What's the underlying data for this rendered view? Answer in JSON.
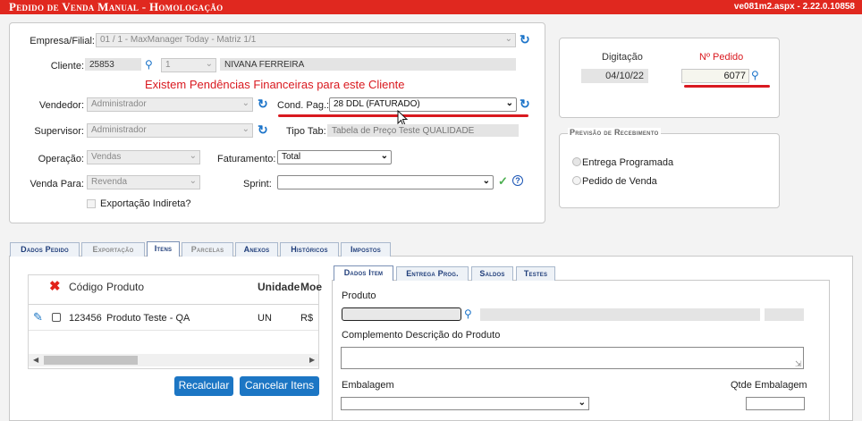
{
  "titlebar": {
    "title": "Pedido de Venda Manual - Homologação",
    "version": "ve081m2.aspx - 2.22.0.10858"
  },
  "form": {
    "empresa_label": "Empresa/Filial:",
    "empresa_value": "01 / 1 - MaxManager Today - Matriz 1/1",
    "cliente_label": "Cliente:",
    "cliente_code": "25853",
    "cliente_seq": "1",
    "cliente_name": "NIVANA FERREIRA",
    "alert": "Existem Pendências Financeiras para este Cliente",
    "vendedor_label": "Vendedor:",
    "vendedor_value": "Administrador",
    "cond_pag_label": "Cond. Pag.:",
    "cond_pag_value": "28 DDL (FATURADO)",
    "supervisor_label": "Supervisor:",
    "supervisor_value": "Administrador",
    "tipo_tab_label": "Tipo Tab:",
    "tipo_tab_value": "Tabela de Preço Teste QUALIDADE",
    "operacao_label": "Operação:",
    "operacao_value": "Vendas",
    "faturamento_label": "Faturamento:",
    "faturamento_value": "Total",
    "venda_para_label": "Venda Para:",
    "venda_para_value": "Revenda",
    "sprint_label": "Sprint:",
    "sprint_value": "",
    "export_label": "Exportação Indireta?"
  },
  "pedido": {
    "digitacao_label": "Digitação",
    "digitacao_value": "04/10/22",
    "numero_label": "Nº Pedido",
    "numero_value": "6077"
  },
  "previsao": {
    "legend": "Previsão de Recebimento",
    "opt1": "Entrega Programada",
    "opt2": "Pedido de Venda"
  },
  "tabs": [
    {
      "label": "Dados Pedido"
    },
    {
      "label": "Exportação"
    },
    {
      "label": "Itens"
    },
    {
      "label": "Parcelas"
    },
    {
      "label": "Anexos"
    },
    {
      "label": "Históricos"
    },
    {
      "label": "Impostos"
    }
  ],
  "items_table": {
    "headers": {
      "codigo": "Código",
      "produto": "Produto",
      "unidade": "Unidade",
      "moeda": "Moe"
    },
    "row": {
      "codigo": "123456",
      "produto": "Produto Teste - QA",
      "unidade": "UN",
      "moeda": "R$"
    }
  },
  "buttons": {
    "recalcular": "Recalcular",
    "cancelar": "Cancelar Itens"
  },
  "subtabs": [
    {
      "label": "Dados Item"
    },
    {
      "label": "Entrega Prog."
    },
    {
      "label": "Saldos"
    },
    {
      "label": "Testes"
    }
  ],
  "item_details": {
    "produto_label": "Produto",
    "complemento_label": "Complemento Descrição do Produto",
    "embalagem_label": "Embalagem",
    "qtde_label": "Qtde Embalagem"
  },
  "colors": {
    "titlebar": "#e0281f",
    "accent": "#1c76c4",
    "alert": "#d9191f"
  }
}
